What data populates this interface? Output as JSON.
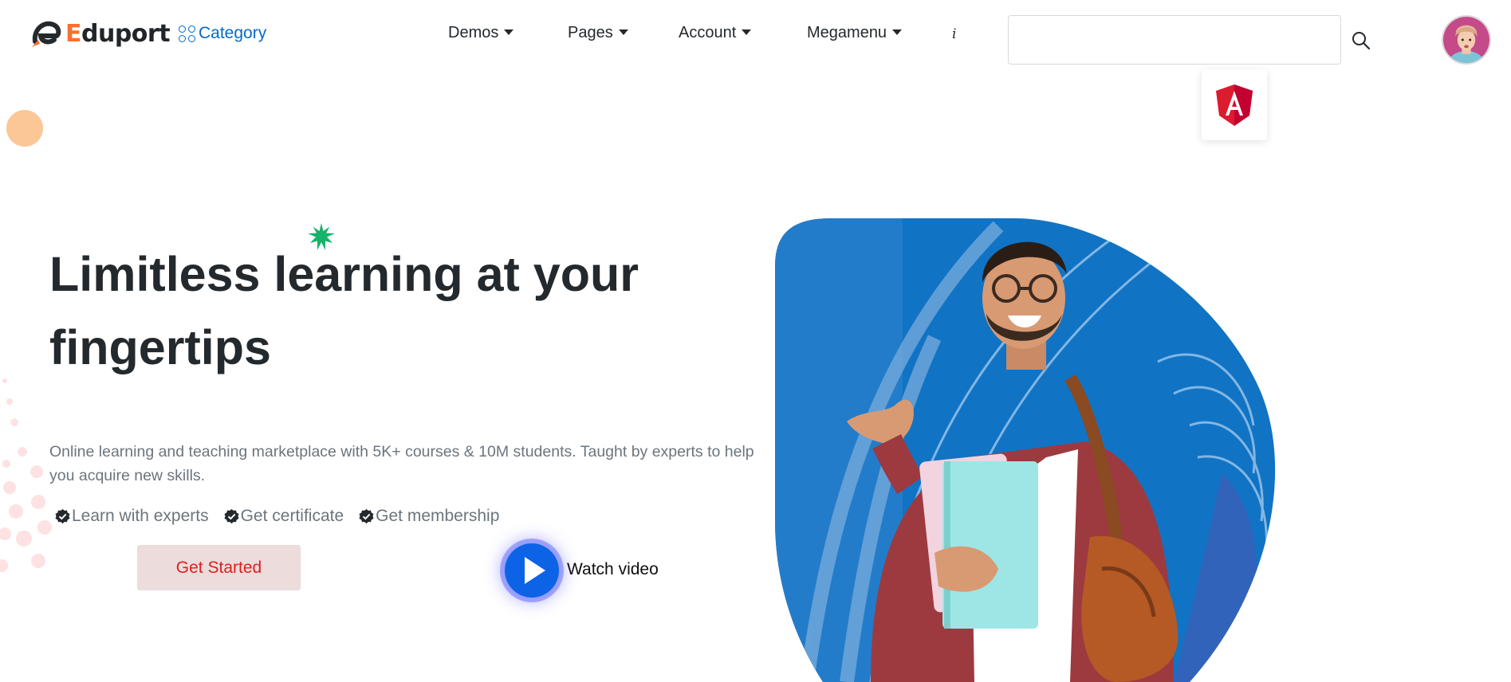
{
  "header": {
    "logo": {
      "text_first": "E",
      "text_rest": "duport",
      "mark": "eduport-logo-icon"
    },
    "category_label": "Category",
    "category_icon": "grid-circles-icon",
    "nav": [
      {
        "label": "Demos"
      },
      {
        "label": "Pages"
      },
      {
        "label": "Account"
      },
      {
        "label": "Megamenu"
      }
    ],
    "info_label": "i",
    "search": {
      "value": "",
      "placeholder": "",
      "icon": "search-icon"
    },
    "avatar": "user-avatar",
    "floating_badge": "angular-icon"
  },
  "hero": {
    "title": "Limitless learning at your fingertips",
    "subtitle": "Online learning and teaching marketplace with 5K+ courses & 10M students. Taught by experts to help you acquire new skills.",
    "features": [
      {
        "label": "Learn with experts",
        "icon": "verified-check-icon"
      },
      {
        "label": "Get certificate",
        "icon": "verified-check-icon"
      },
      {
        "label": "Get membership",
        "icon": "verified-check-icon"
      }
    ],
    "cta_label": "Get Started",
    "video_label": "Watch video",
    "video_icon": "play-icon",
    "image": "student-holding-books-photo"
  },
  "colors": {
    "brand_orange": "#f7712e",
    "brand_blue": "#066ac9",
    "heading": "#24292d",
    "muted": "#6c757d",
    "cta_text": "#e01e1e",
    "cta_bg": "#ecdcdc",
    "play_blue": "#0d63e6",
    "hero_bg_blue": "#1173c4",
    "accent_green": "#17b36b"
  }
}
